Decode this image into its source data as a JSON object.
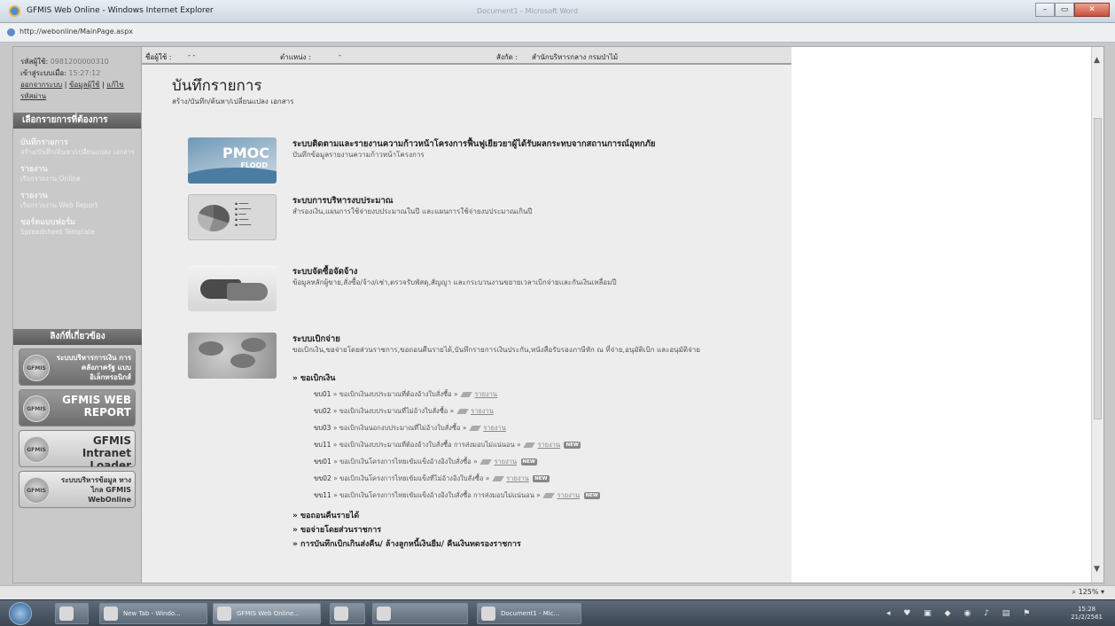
{
  "window": {
    "title": "GFMIS Web Online - Windows Internet Explorer",
    "ghost_title": "Document1 - Microsoft Word",
    "url": "http://webonline/MainPage.aspx"
  },
  "sidebar": {
    "user_label": "รหัสผู้ใช้:",
    "user_value": "0981200000310",
    "login_label": "เข้าสู่ระบบเมื่อ:",
    "login_value": "15:27:12",
    "logout_link": "ออกจากระบบ",
    "profile_link": "ข้อมูลผู้ใช้",
    "password_link": "แก้ไขรหัสผ่าน",
    "menu_header": "เลือกรายการที่ต้องการ",
    "menu": [
      {
        "head": "บันทึกรายการ",
        "sub": "สร้าง/บันทึก/ค้นหา/เปลี่ยนแปลง เอกสาร"
      },
      {
        "head": "รายงาน",
        "sub": "เรียกรายงาน Online"
      },
      {
        "head": "รายงาน",
        "sub": "เรียกรายงาน Web Report"
      },
      {
        "head": "ชอร์ตแบบฟอร์ม",
        "sub": "Spreadsheet Template"
      }
    ],
    "links_header": "ลิงก์ที่เกี่ยวข้อง",
    "banners": [
      {
        "seal": "GFMIS",
        "text": "ระบบบริหารการเงิน การคลังภาครัฐ แบบอิเล็กทรอนิกส์"
      },
      {
        "seal": "GFMIS",
        "text": "GFMIS WEB REPORT"
      },
      {
        "seal": "GFMIS",
        "text": "GFMIS Intranet Loader"
      },
      {
        "seal": "GFMIS",
        "text": "ระบบบริหารข้อมูล ทางไกล GFMIS WebOnline"
      }
    ]
  },
  "topinfo": {
    "user_label": "ชื่อผู้ใช้ :",
    "user_value": "- -",
    "position_label": "ตำแหน่ง :",
    "position_value": "-",
    "dept_label": "สังกัด :",
    "dept_value": "สำนักบริหารกลาง กรมป่าไม้"
  },
  "page": {
    "title": "บันทึกรายการ",
    "subtitle": "สร้าง/บันทึก/ค้นหา/เปลี่ยนแปลง เอกสาร"
  },
  "sections": [
    {
      "thumb_text": "PMOC",
      "thumb_text2": "FLOOD",
      "title": "ระบบติดตามและรายงานความก้าวหน้าโครงการฟื้นฟูเยียวยาผู้ได้รับผลกระทบจากสถานการณ์อุทกภัย",
      "desc": "บันทึกข้อมูลรายงานความก้าวหน้าโครงการ"
    },
    {
      "title": "ระบบการบริหารงบประมาณ",
      "desc": "สำรองเงิน,แผนการใช้จ่ายงบประมาณในปี และแผนการใช้จ่ายงบประมาณเกินปี"
    },
    {
      "title": "ระบบจัดซื้อจัดจ้าง",
      "desc": "ข้อมูลหลักผู้ขาย,สั่งซื้อ/จ้าง/เช่า,ตรวจรับพัสดุ,สัญญา และกระบวนงานขยายเวลาเบิกจ่ายและกันเงินเหลื่อมปี"
    },
    {
      "title": "ระบบเบิกจ่าย",
      "desc": "ขอเบิกเงิน,ขอจ่ายโดยส่วนราชการ,ขอถอนคืนรายได้,บันทึกรายการเงินประกัน,หนังสือรับรองภาษีหัก ณ ที่จ่าย,อนุมัติเบิก และอนุมัติจ่าย"
    }
  ],
  "payment": {
    "group1": "» ขอเบิกเงิน",
    "rows": [
      {
        "code": "ขบ01",
        "text": "» ขอเบิกเงินงบประมาณที่ต้องอ้างใบสั่งซื้อ »",
        "report": "รายงาน",
        "new": false
      },
      {
        "code": "ขบ02",
        "text": "» ขอเบิกเงินงบประมาณที่ไม่อ้างใบสั่งซื้อ »",
        "report": "รายงาน",
        "new": false
      },
      {
        "code": "ขบ03",
        "text": "» ขอเบิกเงินนอกงบประมาณที่ไม่อ้างใบสั่งซื้อ »",
        "report": "รายงาน",
        "new": false
      },
      {
        "code": "ขบ11",
        "text": "» ขอเบิกเงินงบประมาณที่ต้องอ้างใบสั่งซื้อ การส่งมอบไม่แน่นอน »",
        "report": "รายงาน",
        "new": true
      },
      {
        "code": "ขข01",
        "text": "» ขอเบิกเงินโครงการไทยเข้มแข็งอ้างอิงใบสั่งซื้อ »",
        "report": "รายงาน",
        "new": true
      },
      {
        "code": "ขข02",
        "text": "» ขอเบิกเงินโครงการไทยเข้มแข็งที่ไม่อ้างอิงใบสั่งซื้อ »",
        "report": "รายงาน",
        "new": true
      },
      {
        "code": "ขข11",
        "text": "» ขอเบิกเงินโครงการไทยเข้มแข็งอ้างอิงใบสั่งซื้อ การส่งมอบไม่แน่นอน »",
        "report": "รายงาน",
        "new": true
      }
    ],
    "new_badge": "NEW",
    "group2": "» ขอถอนคืนรายได้",
    "group3": "» ขอจ่ายโดยส่วนราชการ",
    "group4": "» การบันทึกเบิกเกินส่งคืน/ ล้างลูกหนี้เงินยืม/ คืนเงินทดรองราชการ"
  },
  "statusbar": {
    "zoom": "125%"
  },
  "taskbar": {
    "buttons": [
      "New Tab - Windo...",
      "GFMIS Web Online...",
      "",
      "",
      "Document1 - Mic..."
    ],
    "clock_time": "15:28",
    "clock_date": "21/2/2561"
  }
}
